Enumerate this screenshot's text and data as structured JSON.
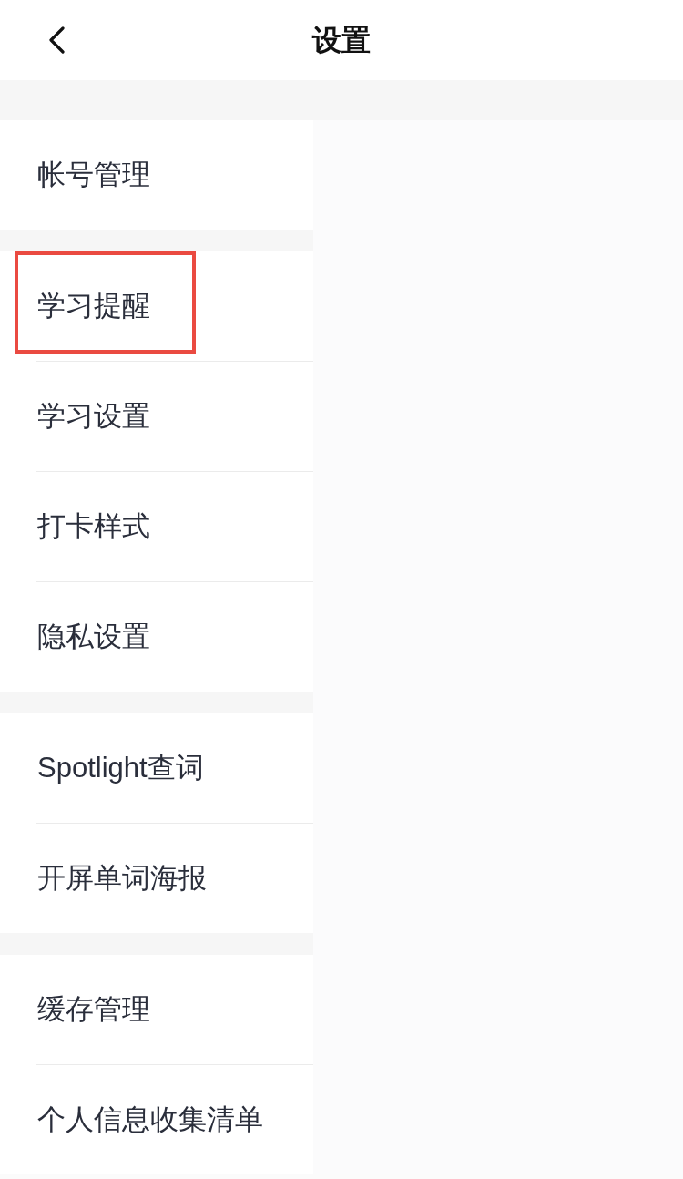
{
  "header": {
    "title": "设置"
  },
  "groups": [
    {
      "items": [
        {
          "label": "帐号管理",
          "highlighted": false
        }
      ]
    },
    {
      "items": [
        {
          "label": "学习提醒",
          "highlighted": true
        },
        {
          "label": "学习设置",
          "highlighted": false
        },
        {
          "label": "打卡样式",
          "highlighted": false
        },
        {
          "label": "隐私设置",
          "highlighted": false
        }
      ]
    },
    {
      "items": [
        {
          "label": "Spotlight查词",
          "highlighted": false
        },
        {
          "label": "开屏单词海报",
          "highlighted": false
        }
      ]
    },
    {
      "items": [
        {
          "label": "缓存管理",
          "highlighted": false
        },
        {
          "label": "个人信息收集清单",
          "highlighted": false
        }
      ]
    }
  ]
}
